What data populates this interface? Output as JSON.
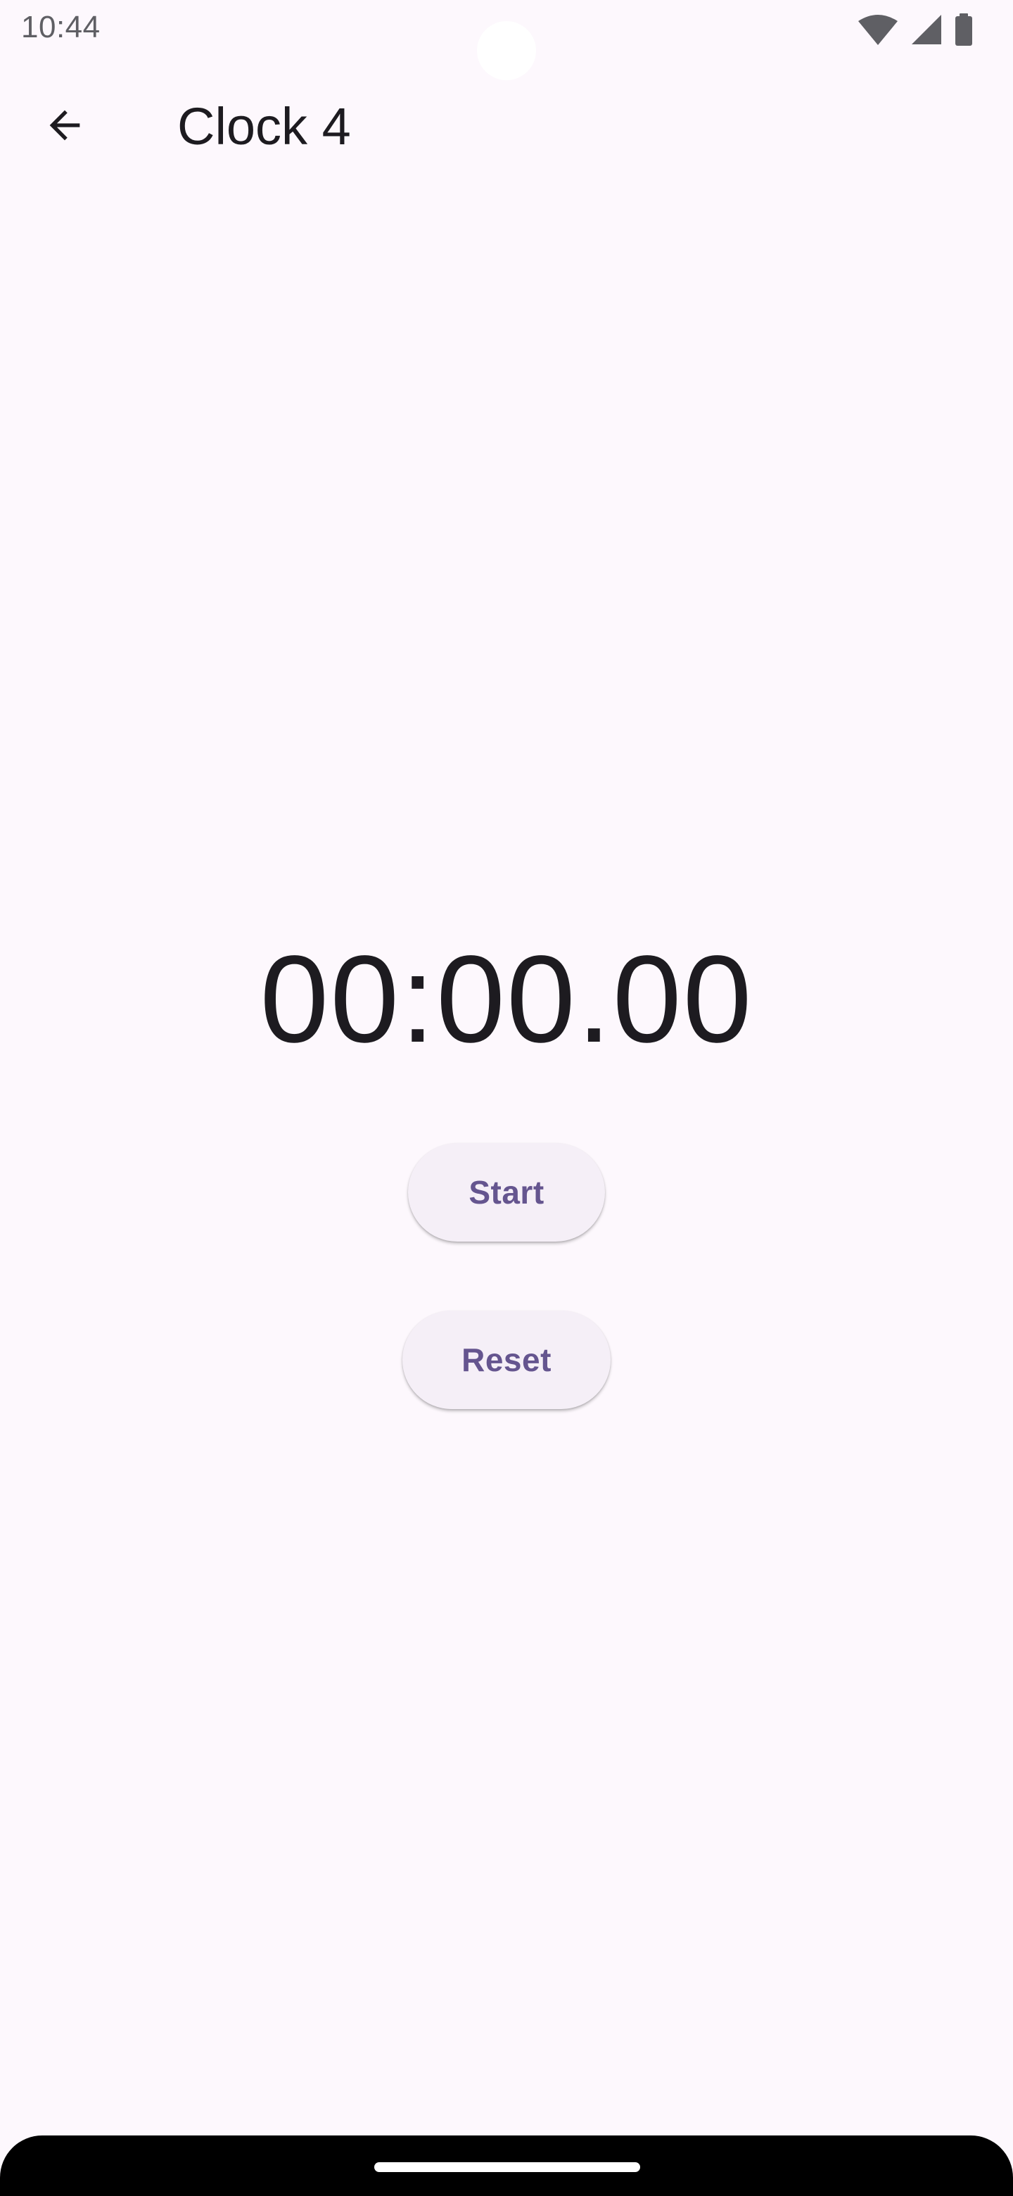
{
  "status_bar": {
    "time": "10:44",
    "icons": [
      "wifi-icon",
      "cellular-signal-icon",
      "battery-icon"
    ]
  },
  "app_bar": {
    "back_icon": "arrow-back-icon",
    "title": "Clock 4"
  },
  "stopwatch": {
    "display": "00:00.00"
  },
  "actions": {
    "start_label": "Start",
    "reset_label": "Reset"
  },
  "colors": {
    "background": "#fdf8fd",
    "button_background": "#f5eff7",
    "button_text": "#65558f",
    "primary_text": "#1d1b20"
  }
}
